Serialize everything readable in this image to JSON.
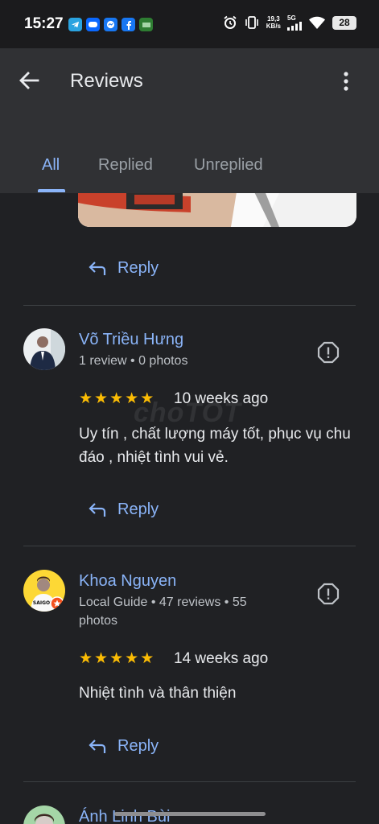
{
  "status_bar": {
    "time": "15:27",
    "net_speed_value": "19,3",
    "net_speed_unit": "KB/s",
    "network": "5G",
    "battery": "28",
    "notification_icons": [
      "telegram-icon",
      "zalo-icon",
      "messenger-icon",
      "facebook-icon",
      "app-icon"
    ]
  },
  "app_bar": {
    "title": "Reviews",
    "tabs": [
      {
        "label": "All",
        "active": true
      },
      {
        "label": "Replied",
        "active": false
      },
      {
        "label": "Unreplied",
        "active": false
      }
    ]
  },
  "reply_label": "Reply",
  "reviews": [
    {
      "name": "Võ Triều Hưng",
      "meta": "1 review • 0 photos",
      "stars": 5,
      "when": "10 weeks ago",
      "text": "Uy tín , chất lượng máy tốt, phục vụ chu đáo , nhiệt tình vui vẻ."
    },
    {
      "name": "Khoa Nguyen",
      "meta": "Local Guide • 47 reviews • 55 photos",
      "stars": 5,
      "when": "14 weeks ago",
      "text": "Nhiệt tình và thân thiện",
      "avatar_shirt_text": "SAIGON"
    },
    {
      "name": "Ánh Linh Bùi"
    }
  ],
  "watermark": "choTOT",
  "colors": {
    "accent": "#8ab4f8",
    "star": "#fbbc04",
    "background": "#202124",
    "app_bar": "#303134"
  }
}
